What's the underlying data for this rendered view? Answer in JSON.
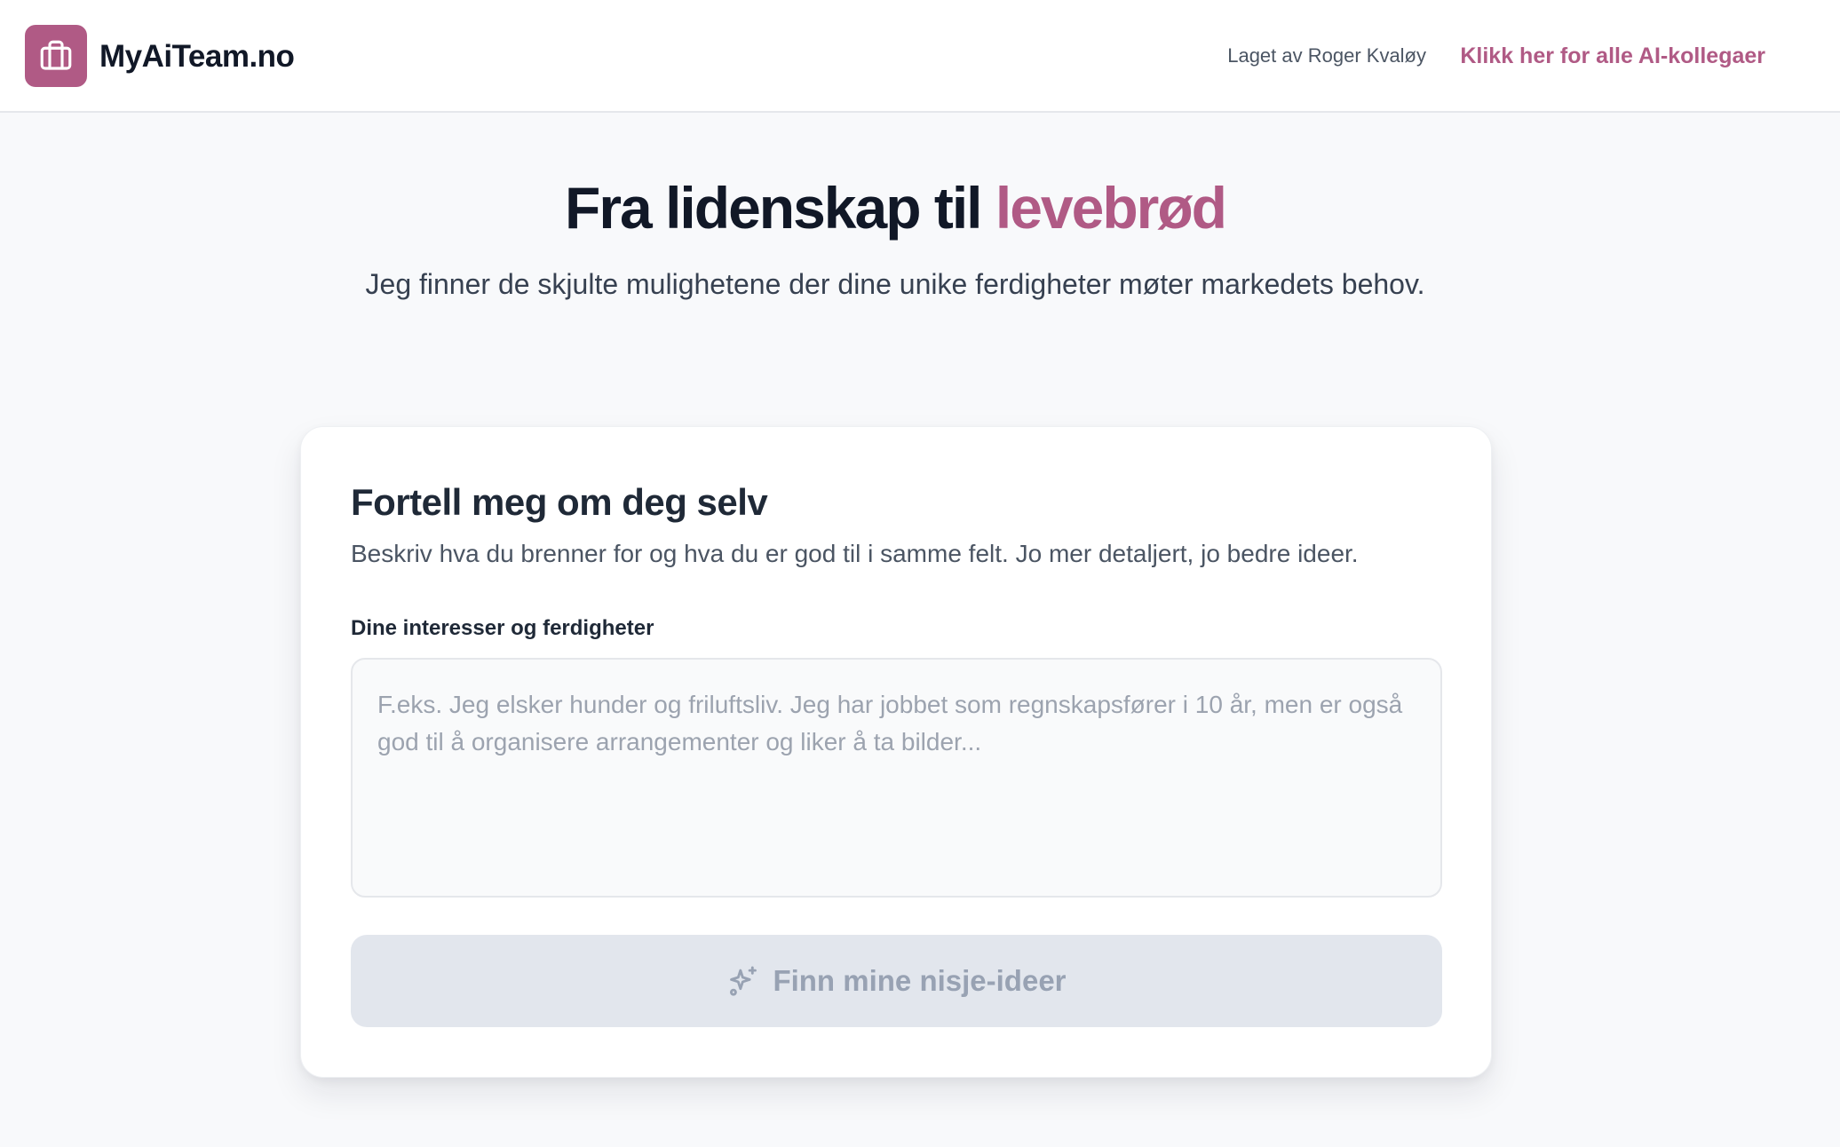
{
  "header": {
    "brand": "MyAiTeam.no",
    "logo_icon": "briefcase-icon",
    "credit": "Laget av Roger Kvaløy",
    "nav_link": "Klikk her for alle AI-kollegaer"
  },
  "hero": {
    "title_main": "Fra lidenskap til",
    "title_accent": "levebrød",
    "subtitle": "Jeg finner de skjulte mulighetene der dine unike ferdigheter møter markedets behov."
  },
  "card": {
    "title": "Fortell meg om deg selv",
    "description": "Beskriv hva du brenner for og hva du er god til i samme felt. Jo mer detaljert, jo bedre ideer.",
    "field_label": "Dine interesser og ferdigheter",
    "textarea": {
      "value": "",
      "placeholder": "F.eks. Jeg elsker hunder og friluftsliv. Jeg har jobbet som regnskapsfører i 10 år, men er også god til å organisere arrangementer og liker å ta bilder..."
    },
    "submit": {
      "label": "Finn mine nisje-ideer",
      "icon": "sparkles-icon",
      "disabled": true
    }
  },
  "colors": {
    "accent": "#b05a85",
    "background": "#f8f9fb",
    "button_disabled": "#e2e6ed"
  }
}
